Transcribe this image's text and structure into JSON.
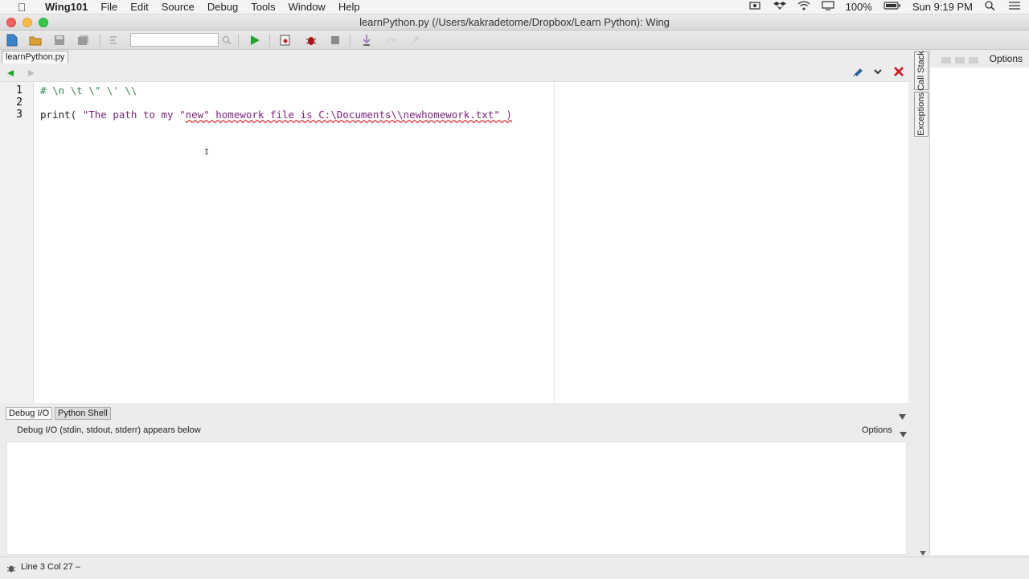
{
  "menubar": {
    "app_name": "Wing101",
    "menus": [
      "File",
      "Edit",
      "Source",
      "Debug",
      "Tools",
      "Window",
      "Help"
    ],
    "battery": "100%",
    "clock": "Sun 9:19 PM"
  },
  "window": {
    "title": "learnPython.py (/Users/kakradetome/Dropbox/Learn Python): Wing"
  },
  "toolbar": {
    "search_value": "",
    "icons": [
      "new-file-icon",
      "open-folder-icon",
      "save-icon",
      "save-all-icon",
      "find-icon",
      "search-icon",
      "run-icon",
      "debug-record-icon",
      "bug-icon",
      "stop-icon",
      "step-into-icon",
      "step-over-icon",
      "step-out-icon"
    ]
  },
  "editor": {
    "tab_label": "learnPython.py",
    "lines": [
      {
        "number": "1",
        "text": "# \\n \\t \\\" \\' \\\\"
      },
      {
        "number": "2",
        "text": ""
      },
      {
        "number": "3",
        "fn": "print( ",
        "str_a": "\"The path to my \"",
        "str_b": "new\" homework file is C:\\Documents\\\\newhomework.txt\" )"
      }
    ]
  },
  "right_panel": {
    "options_label": "Options",
    "vtabs": [
      "Call Stack",
      "Exceptions"
    ]
  },
  "bottom_panel": {
    "tabs": [
      "Debug I/O",
      "Python Shell"
    ],
    "active_tab": "Debug I/O",
    "description": "Debug I/O (stdin, stdout, stderr) appears below",
    "options_label": "Options"
  },
  "status": {
    "text": "Line 3 Col 27 –"
  },
  "colors": {
    "run_green": "#1fa81f",
    "close_red": "#cc1111",
    "comment": "#2e8b57",
    "string": "#7a1f7a"
  }
}
